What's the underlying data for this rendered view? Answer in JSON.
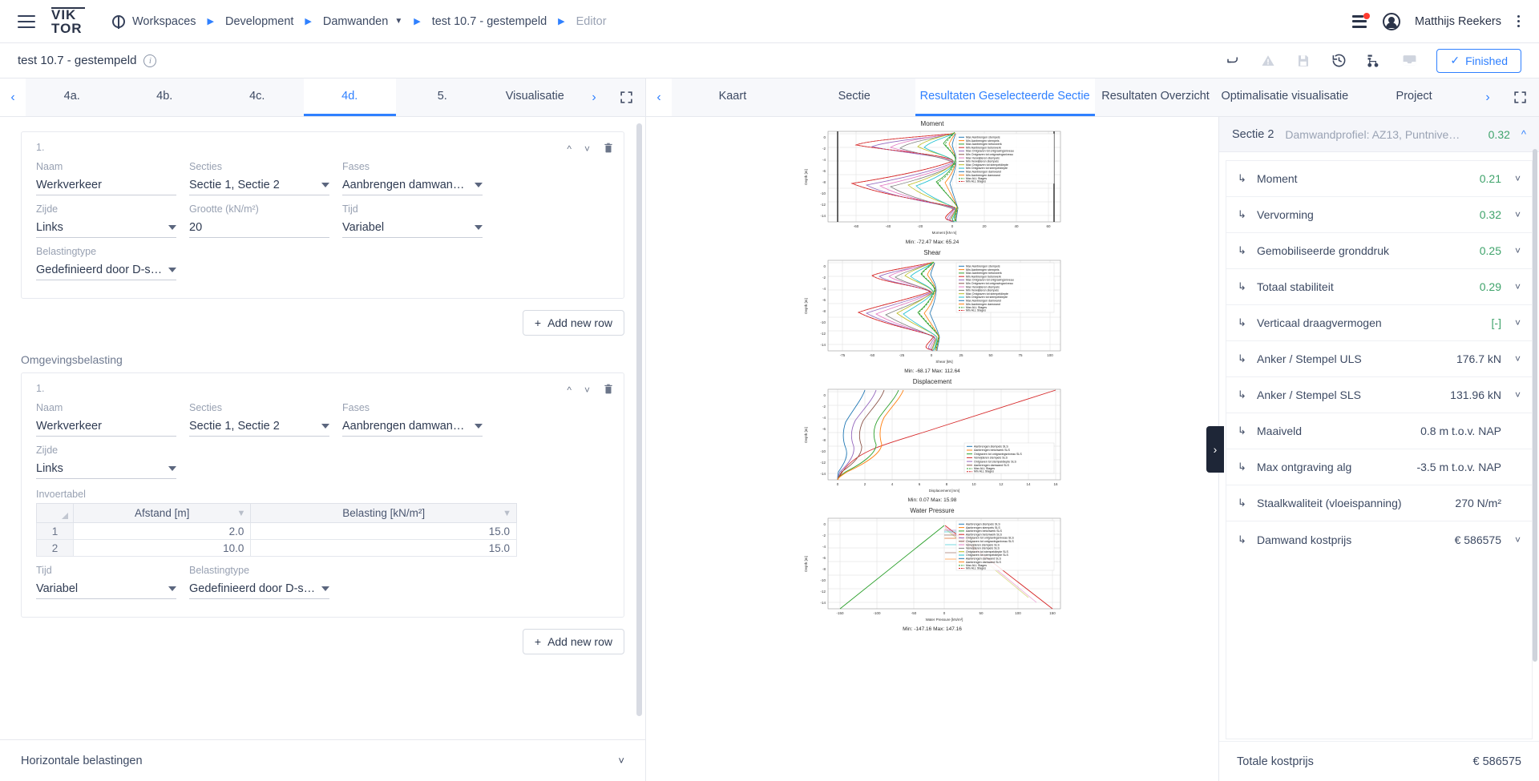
{
  "topbar": {
    "logo_line1": "VIK",
    "logo_line2": "TOR",
    "breadcrumbs": [
      {
        "label": "Workspaces",
        "icon": "globe-icon",
        "muted": false,
        "caret": false
      },
      {
        "label": "Development",
        "muted": false,
        "caret": false
      },
      {
        "label": "Damwanden",
        "muted": false,
        "caret": true
      },
      {
        "label": "test 10.7 - gestempeld",
        "muted": false,
        "caret": false
      },
      {
        "label": "Editor",
        "muted": true,
        "caret": false
      }
    ],
    "username": "Matthijs Reekers"
  },
  "subbar": {
    "title": "test 10.7 - gestempeld",
    "info_icon": "info-icon",
    "icons": [
      "undo-icon",
      "warning-icon",
      "save-icon",
      "history-icon",
      "tree-icon",
      "inbox-icon"
    ],
    "finished_label": "Finished",
    "finished_check": "✓"
  },
  "left": {
    "tabs": [
      {
        "label": "4a.",
        "active": false
      },
      {
        "label": "4b.",
        "active": false
      },
      {
        "label": "4c.",
        "active": false
      },
      {
        "label": "4d.",
        "active": true
      },
      {
        "label": "5.",
        "active": false
      },
      {
        "label": "Visualisatie",
        "active": false
      }
    ],
    "prev_arrow": "‹",
    "next_arrow": "›",
    "expand_icon": "fullscreen-icon",
    "card1": {
      "index": "1.",
      "fields": [
        {
          "label": "Naam",
          "value": "Werkverkeer",
          "type": "text"
        },
        {
          "label": "Secties",
          "value": "Sectie 1, Sectie 2",
          "type": "select"
        },
        {
          "label": "Fases",
          "value": "Aanbrengen damwan…",
          "type": "select"
        },
        {
          "label": "Zijde",
          "value": "Links",
          "type": "select"
        },
        {
          "label": "Grootte (kN/m²)",
          "value": "20",
          "type": "text"
        },
        {
          "label": "Tijd",
          "value": "Variabel",
          "type": "select"
        },
        {
          "label": "Belastingtype",
          "value": "Gedefinieerd door D-s…",
          "type": "select"
        }
      ]
    },
    "add_row_label": "Add new row",
    "add_row_plus": "+",
    "section_label": "Omgevingsbelasting",
    "card2": {
      "index": "1.",
      "fields": [
        {
          "label": "Naam",
          "value": "Werkverkeer",
          "type": "text"
        },
        {
          "label": "Secties",
          "value": "Sectie 1, Sectie 2",
          "type": "select"
        },
        {
          "label": "Fases",
          "value": "Aanbrengen damwan…",
          "type": "select"
        },
        {
          "label": "Zijde",
          "value": "Links",
          "type": "select"
        }
      ],
      "table_label": "Invoertabel",
      "table": {
        "headers": [
          "Afstand [m]",
          "Belasting [kN/m²]"
        ],
        "rows": [
          {
            "idx": "1",
            "afstand": "2.0",
            "belasting": "15.0"
          },
          {
            "idx": "2",
            "afstand": "10.0",
            "belasting": "15.0"
          }
        ]
      },
      "bottom_fields": [
        {
          "label": "Tijd",
          "value": "Variabel",
          "type": "select"
        },
        {
          "label": "Belastingtype",
          "value": "Gedefinieerd door D-s…",
          "type": "select"
        }
      ]
    },
    "add_row_label2": "Add new row",
    "accordion_label": "Horizontale belastingen"
  },
  "right": {
    "tabs": [
      {
        "label": "Kaart",
        "active": false
      },
      {
        "label": "Sectie",
        "active": false
      },
      {
        "label": "Resultaten Geselecteerde Sectie",
        "active": true
      },
      {
        "label": "Resultaten Overzicht",
        "active": false
      },
      {
        "label": "Optimalisatie visualisatie",
        "active": false
      },
      {
        "label": "Project",
        "active": false
      }
    ],
    "prev_arrow": "‹",
    "next_arrow": "›",
    "expand_icon": "fullscreen-icon",
    "fab_icon": "more-options-icon",
    "drawer_icon": "›",
    "panel": {
      "section_name": "Sectie 2",
      "profile": "Damwandprofiel: AZ13, Puntnive…",
      "unity": "0.32",
      "collapse_icon": "chevron-up-icon",
      "rows": [
        {
          "name": "Moment",
          "value": "0.21",
          "green": true,
          "chevron": true
        },
        {
          "name": "Vervorming",
          "value": "0.32",
          "green": true,
          "chevron": true
        },
        {
          "name": "Gemobiliseerde gronddruk",
          "value": "0.25",
          "green": true,
          "chevron": true
        },
        {
          "name": "Totaal stabiliteit",
          "value": "0.29",
          "green": true,
          "chevron": true
        },
        {
          "name": "Verticaal draagvermogen",
          "value": "[-]",
          "green": true,
          "chevron": true
        },
        {
          "name": "Anker / Stempel ULS",
          "value": "176.7 kN",
          "green": false,
          "chevron": true
        },
        {
          "name": "Anker / Stempel SLS",
          "value": "131.96 kN",
          "green": false,
          "chevron": true
        },
        {
          "name": "Maaiveld",
          "value": "0.8 m t.o.v. NAP",
          "green": false,
          "chevron": false
        },
        {
          "name": "Max ontgraving alg",
          "value": "-3.5 m t.o.v. NAP",
          "green": false,
          "chevron": false
        },
        {
          "name": "Staalkwaliteit (vloeispanning)",
          "value": "270 N/m²",
          "green": false,
          "chevron": false
        },
        {
          "name": "Damwand kostprijs",
          "value": "€ 586575",
          "green": false,
          "chevron": true
        }
      ],
      "total_label": "Totale kostprijs",
      "total_value": "€ 586575"
    }
  },
  "chart_data": [
    {
      "type": "line",
      "title": "Moment",
      "xlabel": "Moment [kN·m]",
      "ylabel": "Depth [m]",
      "footnote": "Min: -72.47    Max: 65.24",
      "xticks": [
        -60,
        -40,
        -20,
        0,
        20,
        40,
        60
      ],
      "yticks": [
        0,
        -2,
        -4,
        -6,
        -8,
        -10,
        -12,
        -14
      ],
      "xlim": [
        -75,
        70
      ],
      "ylim": [
        -15.5,
        1.0
      ],
      "grid": true,
      "legend_position": "upper right",
      "series": [
        {
          "name": "Max Aanbrengen stempels",
          "color": "#1f77b4"
        },
        {
          "name": "Min Aanbrengen stempels",
          "color": "#ff7f0e"
        },
        {
          "name": "Max Aanbrengen betonwerk",
          "color": "#2ca02c"
        },
        {
          "name": "Min Aanbrengen betonwerk",
          "color": "#d62728"
        },
        {
          "name": "Max Ontgraven tot ontgravingsniveau",
          "color": "#9467bd"
        },
        {
          "name": "Min Ontgraven tot ontgravingsniveau",
          "color": "#8c564b"
        },
        {
          "name": "Max Verwijderen stempels",
          "color": "#e377c2"
        },
        {
          "name": "Min Verwijderen stempels",
          "color": "#7f7f7f"
        },
        {
          "name": "Max Ontgraven tot stempeldiepte",
          "color": "#bcbd22"
        },
        {
          "name": "Min Ontgraven tot stempeldiepte",
          "color": "#17becf"
        },
        {
          "name": "Max Aanbrengen damwand",
          "color": "#1f77b4"
        },
        {
          "name": "Min Aanbrengen damwand",
          "color": "#ff7f0e"
        },
        {
          "name": "Max ALL Stages",
          "color": "#2ca02c"
        },
        {
          "name": "Min ALL Stages",
          "color": "#d62728"
        }
      ]
    },
    {
      "type": "line",
      "title": "Shear",
      "xlabel": "Shear [kN]",
      "ylabel": "Depth [m]",
      "footnote": "Min: -68.17    Max: 112.64",
      "xticks": [
        -75,
        -50,
        -25,
        0,
        25,
        50,
        75,
        100
      ],
      "yticks": [
        0,
        -2,
        -4,
        -6,
        -8,
        -10,
        -12,
        -14
      ],
      "xlim": [
        -85,
        115
      ],
      "ylim": [
        -15.5,
        1.0
      ],
      "grid": true,
      "legend_position": "upper right",
      "series": [
        {
          "name": "Max Aanbrengen stempels",
          "color": "#1f77b4"
        },
        {
          "name": "Min Aanbrengen stempels",
          "color": "#ff7f0e"
        },
        {
          "name": "Max Aanbrengen betonwerk",
          "color": "#2ca02c"
        },
        {
          "name": "Min Aanbrengen betonwerk",
          "color": "#d62728"
        },
        {
          "name": "Max Ontgraven tot ontgravingsniveau",
          "color": "#9467bd"
        },
        {
          "name": "Min Ontgraven tot ontgravingsniveau",
          "color": "#8c564b"
        },
        {
          "name": "Max Verwijderen stempels",
          "color": "#e377c2"
        },
        {
          "name": "Min Verwijderen stempels",
          "color": "#7f7f7f"
        },
        {
          "name": "Max Ontgraven tot stempeldiepte",
          "color": "#bcbd22"
        },
        {
          "name": "Min Ontgraven tot stempeldiepte",
          "color": "#17becf"
        },
        {
          "name": "Max Aanbrengen damwand",
          "color": "#1f77b4"
        },
        {
          "name": "Min Aanbrengen damwand",
          "color": "#ff7f0e"
        },
        {
          "name": "Max ALL Stages",
          "color": "#2ca02c"
        },
        {
          "name": "Min ALL Stages",
          "color": "#d62728"
        }
      ]
    },
    {
      "type": "line",
      "title": "Displacement",
      "xlabel": "Displacement [mm]",
      "ylabel": "Depth [m]",
      "footnote": "Min: 0.07    Max: 15.98",
      "xticks": [
        0,
        2,
        4,
        6,
        8,
        10,
        12,
        14,
        16
      ],
      "yticks": [
        0,
        -2,
        -4,
        -6,
        -8,
        -10,
        -12,
        -14
      ],
      "xlim": [
        -1,
        17
      ],
      "ylim": [
        -15.5,
        1.0
      ],
      "grid": true,
      "legend_position": "lower right",
      "series": [
        {
          "name": "Aanbrengen stempels SLS",
          "color": "#1f77b4"
        },
        {
          "name": "Aanbrengen betonwerk SLS",
          "color": "#ff7f0e"
        },
        {
          "name": "Ontgraven tot ontgravingsniveau SLS",
          "color": "#2ca02c"
        },
        {
          "name": "Verwijderen stempels SLS",
          "color": "#d62728"
        },
        {
          "name": "Ontgraven tot stempeldiepte SLS",
          "color": "#9467bd"
        },
        {
          "name": "Aanbrengen damwand SLS",
          "color": "#8c564b"
        },
        {
          "name": "Max ALL Stages",
          "color": "#2ca02c"
        },
        {
          "name": "Min ALL Stages",
          "color": "#d62728"
        }
      ]
    },
    {
      "type": "line",
      "title": "Water Pressure",
      "xlabel": "Water Pressure [kN/m²]",
      "ylabel": "Depth [m]",
      "footnote": "Min: -147.16    Max: 147.16",
      "xticks": [
        -150,
        -100,
        -50,
        0,
        50,
        100,
        150
      ],
      "yticks": [
        0,
        -2,
        -4,
        -6,
        -8,
        -10,
        -12,
        -14
      ],
      "xlim": [
        -165,
        165
      ],
      "ylim": [
        -15.5,
        1.0
      ],
      "grid": true,
      "legend_position": "upper right",
      "series": [
        {
          "name": "Aanbrengen stempels SLS",
          "color": "#1f77b4"
        },
        {
          "name": "Aanbrengen stempels SLS",
          "color": "#ff7f0e"
        },
        {
          "name": "Aanbrengen betonwerk SLS",
          "color": "#2ca02c"
        },
        {
          "name": "Aanbrengen betonwerk SLS",
          "color": "#d62728"
        },
        {
          "name": "Ontgraven tot ontgravingsniveau SLS",
          "color": "#9467bd"
        },
        {
          "name": "Ontgraven tot ontgravingsniveau SLS",
          "color": "#8c564b"
        },
        {
          "name": "Verwijderen stempels SLS",
          "color": "#e377c2"
        },
        {
          "name": "Verwijderen stempels SLS",
          "color": "#7f7f7f"
        },
        {
          "name": "Ontgraven tot stempeldiepte SLS",
          "color": "#bcbd22"
        },
        {
          "name": "Ontgraven tot stempeldiepte SLS",
          "color": "#17becf"
        },
        {
          "name": "Aanbrengen damwand SLS",
          "color": "#1f77b4"
        },
        {
          "name": "Aanbrengen damwand SLS",
          "color": "#ff7f0e"
        },
        {
          "name": "Max ALL Stages",
          "color": "#2ca02c"
        },
        {
          "name": "Min ALL Stages",
          "color": "#d62728"
        }
      ]
    }
  ]
}
